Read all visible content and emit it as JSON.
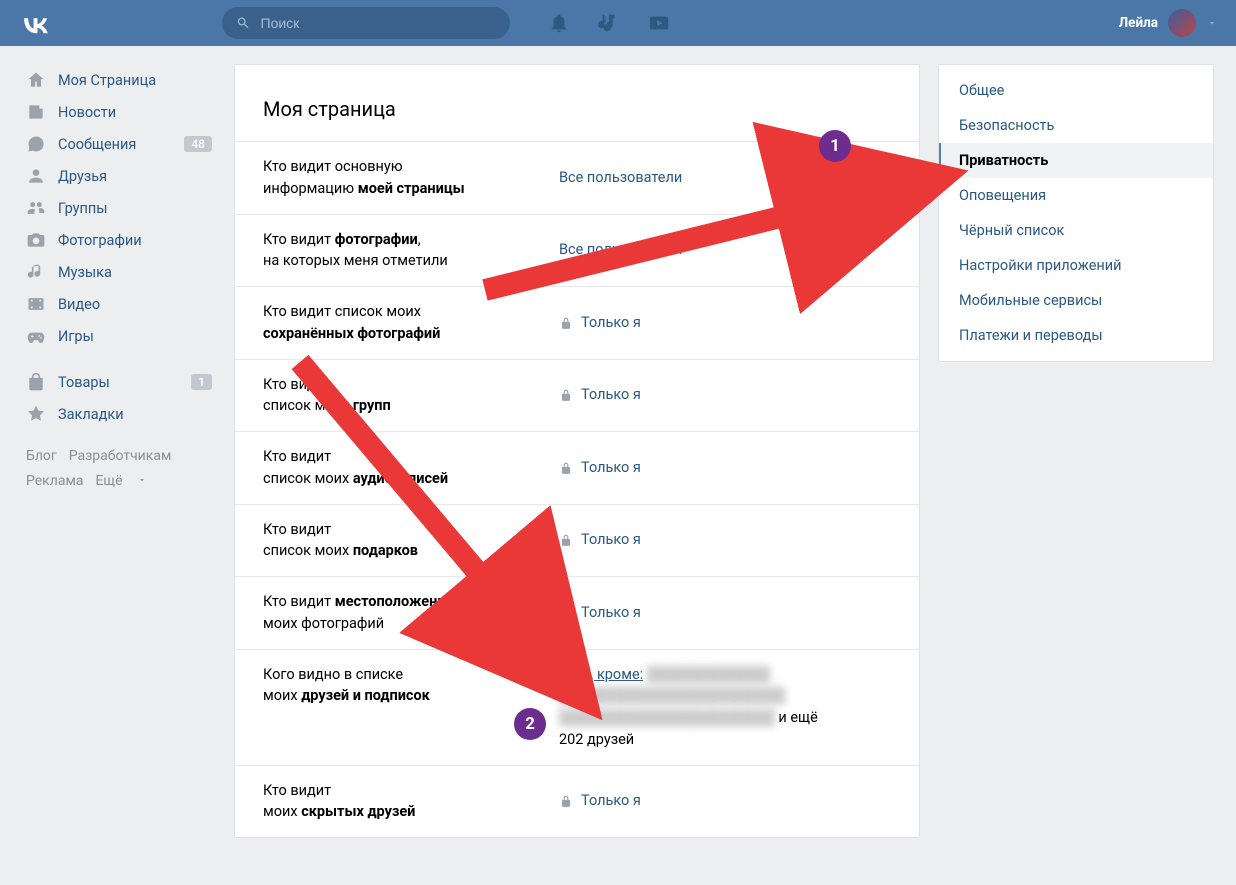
{
  "header": {
    "search_placeholder": "Поиск",
    "username": "Лейла"
  },
  "sidebar": {
    "items": [
      {
        "icon": "home",
        "label": "Моя Страница"
      },
      {
        "icon": "news",
        "label": "Новости"
      },
      {
        "icon": "msg",
        "label": "Сообщения",
        "badge": "48"
      },
      {
        "icon": "user",
        "label": "Друзья"
      },
      {
        "icon": "group",
        "label": "Группы"
      },
      {
        "icon": "photo",
        "label": "Фотографии"
      },
      {
        "icon": "music",
        "label": "Музыка"
      },
      {
        "icon": "video",
        "label": "Видео"
      },
      {
        "icon": "game",
        "label": "Игры"
      }
    ],
    "items2": [
      {
        "icon": "bag",
        "label": "Товары",
        "badge": "1"
      },
      {
        "icon": "star",
        "label": "Закладки"
      }
    ],
    "footer": {
      "blog": "Блог",
      "dev": "Разработчикам",
      "ads": "Реклама",
      "more": "Ещё"
    }
  },
  "main": {
    "title": "Моя страница",
    "rows": [
      {
        "pre": "Кто видит основную",
        "post": "информацию ",
        "bold": "моей страницы",
        "value": "Все пользователи",
        "lock": false
      },
      {
        "pre": "Кто видит ",
        "bold": "фотографии",
        "mid": ",",
        "post2": "на которых меня отметили",
        "value": "Все пользователи",
        "lock": false
      },
      {
        "pre": "Кто видит список моих",
        "post": "",
        "bold": "сохранённых фотографий",
        "value": "Только я",
        "lock": true
      },
      {
        "pre": "Кто видит",
        "post": "список моих ",
        "bold": "групп",
        "value": "Только я",
        "lock": true
      },
      {
        "pre": "Кто видит",
        "post": "список моих ",
        "bold": "аудиозаписей",
        "value": "Только я",
        "lock": true
      },
      {
        "pre": "Кто видит",
        "post": "список моих ",
        "bold": "подарков",
        "value": "Только я",
        "lock": true
      },
      {
        "pre": "Кто видит ",
        "bold": "местоположение",
        "post2": "моих фотографий",
        "value": "Только я",
        "lock": true
      },
      {
        "pre": "Кого видно в списке",
        "post": "моих ",
        "bold": "друзей и подписок",
        "value": "Всех, кроме:",
        "special": "friends",
        "remainder": "и ещё 202 друзей"
      },
      {
        "pre": "Кто видит",
        "post": "моих ",
        "bold": "скрытых друзей",
        "value": "Только я",
        "lock": true
      }
    ]
  },
  "side_menu": {
    "items": [
      {
        "label": "Общее"
      },
      {
        "label": "Безопасность"
      },
      {
        "label": "Приватность",
        "active": true
      },
      {
        "label": "Оповещения"
      },
      {
        "label": "Чёрный список"
      },
      {
        "label": "Настройки приложений"
      },
      {
        "label": "Мобильные сервисы"
      },
      {
        "label": "Платежи и переводы"
      }
    ]
  },
  "annotations": {
    "badge1": "1",
    "badge2": "2"
  }
}
